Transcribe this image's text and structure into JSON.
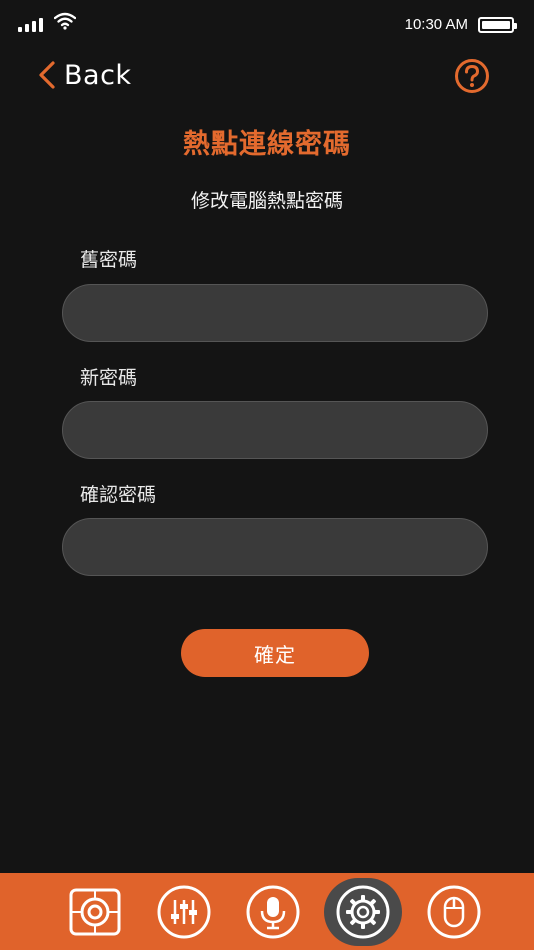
{
  "status_bar": {
    "time": "10:30 AM"
  },
  "nav": {
    "back_label": "Back",
    "help_icon": "question-circle-icon"
  },
  "page": {
    "title": "熱點連線密碼",
    "subtitle": "修改電腦熱點密碼"
  },
  "form": {
    "old_password_label": "舊密碼",
    "old_password_value": "",
    "new_password_label": "新密碼",
    "new_password_value": "",
    "confirm_password_label": "確認密碼",
    "confirm_password_value": "",
    "submit_label": "確定"
  },
  "tab_bar": {
    "items": [
      {
        "icon": "touchpad-target-icon",
        "active": false
      },
      {
        "icon": "equalizer-sliders-icon",
        "active": false
      },
      {
        "icon": "microphone-icon",
        "active": false
      },
      {
        "icon": "settings-gear-icon",
        "active": true
      },
      {
        "icon": "mouse-icon",
        "active": false
      }
    ]
  },
  "colors": {
    "accent": "#e36a2e",
    "background": "#141414",
    "field_background": "#3a3a3a",
    "tab_active_background": "#4a4a4a"
  }
}
